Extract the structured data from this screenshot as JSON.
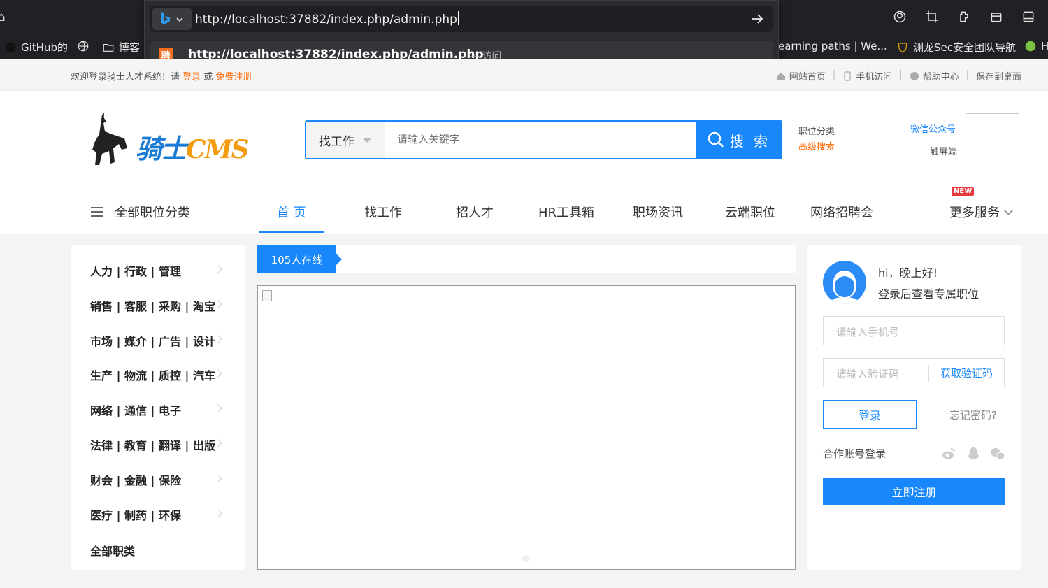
{
  "browser": {
    "bookmarks": [
      {
        "label": "GitHub的"
      },
      {
        "label": ""
      },
      {
        "label": "博客"
      },
      {
        "label": "earning paths | We..."
      },
      {
        "label": "渊龙Sec安全团队导航"
      },
      {
        "label": "H"
      }
    ],
    "omnibox": {
      "url_text": "http://localhost:37882/index.php/admin.php",
      "suggestion_url": "http://localhost:37882/index.php/admin.php",
      "suggestion_action": "— 访问",
      "favicon_char": "聘"
    }
  },
  "topbar": {
    "welcome": "欢迎登录骑士人才系统！请",
    "login_link": "登录",
    "or": "或",
    "register_link": "免费注册",
    "links": [
      "网站首页",
      "手机访问",
      "帮助中心",
      "保存到桌面"
    ]
  },
  "header": {
    "logo_text": "骑士",
    "logo_cms": "CMS",
    "search_type": "找工作",
    "search_placeholder": "请输入关键字",
    "search_button": "搜 索",
    "link_category": "职位分类",
    "link_advanced": "高级搜索",
    "wechat": "微信公众号",
    "touch": "触屏端"
  },
  "nav": {
    "all_categories": "全部职位分类",
    "items": [
      "首 页",
      "找工作",
      "招人才",
      "HR工具箱",
      "职场资讯",
      "云端职位",
      "网络招聘会"
    ],
    "more": "更多服务",
    "new_badge": "NEW"
  },
  "categories": [
    "人力 | 行政 | 管理",
    "销售 | 客服 | 采购 | 淘宝",
    "市场 | 媒介 | 广告 | 设计",
    "生产 | 物流 | 质控 | 汽车",
    "网络 | 通信 | 电子",
    "法律 | 教育 | 翻译 | 出版",
    "财会 | 金融 | 保险",
    "医疗 | 制药 | 环保",
    "全部职类"
  ],
  "online": {
    "text": "105人在线"
  },
  "login": {
    "greet1": "hi，晚上好!",
    "greet2": "登录后查看专属职位",
    "phone_placeholder": "请输入手机号",
    "code_placeholder": "请输入验证码",
    "get_code": "获取验证码",
    "login_button": "登录",
    "forgot": "忘记密码?",
    "coop": "合作账号登录",
    "register_button": "立即注册"
  },
  "colors": {
    "accent": "#1787fb",
    "orange": "#ff6600",
    "new_badge": "#e6393d"
  }
}
